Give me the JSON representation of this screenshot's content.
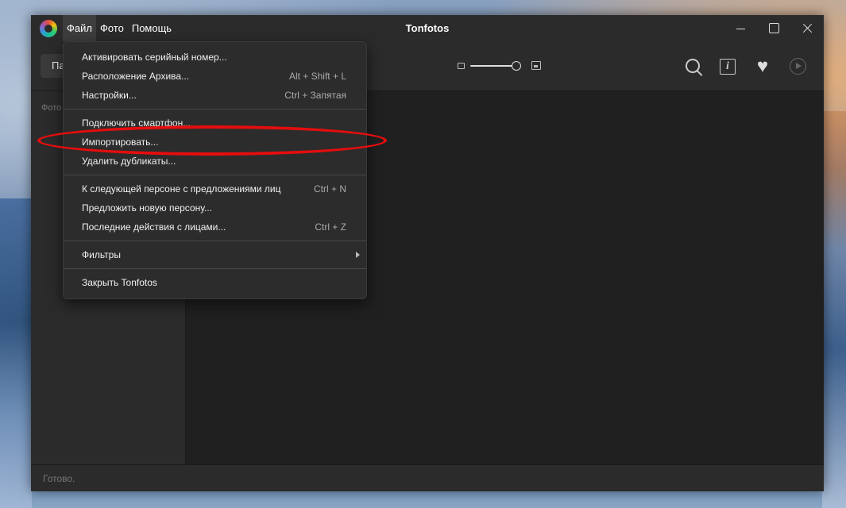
{
  "window": {
    "title": "Tonfotos",
    "menu": [
      "Файл",
      "Фото",
      "Помощь"
    ]
  },
  "toolbar": {
    "tab_partial_label": "Па",
    "zoom_slider_fraction": 1.0
  },
  "sidebar": {
    "section_label": "Фото"
  },
  "status": {
    "text": "Готово."
  },
  "file_menu": {
    "items": [
      {
        "label": "Активировать серийный номер...",
        "shortcut": ""
      },
      {
        "label": "Расположение Архива...",
        "shortcut": "Alt + Shift + L"
      },
      {
        "label": "Настройки...",
        "shortcut": "Ctrl + Запятая"
      },
      {
        "label": "Подключить смартфон...",
        "shortcut": ""
      },
      {
        "label": "Импортировать...",
        "shortcut": ""
      },
      {
        "label": "Удалить дубликаты...",
        "shortcut": ""
      },
      {
        "label": "К следующей персоне с предложениями лиц",
        "shortcut": "Ctrl + N"
      },
      {
        "label": "Предложить новую персону...",
        "shortcut": ""
      },
      {
        "label": "Последние действия с лицами...",
        "shortcut": "Ctrl + Z"
      },
      {
        "label": "Фильтры",
        "shortcut": ""
      },
      {
        "label": "Закрыть Tonfotos",
        "shortcut": ""
      }
    ]
  },
  "colors": {
    "highlight_ellipse": "#e50d0d",
    "window_bg": "#202020",
    "panel_bg": "#2b2b2b"
  },
  "icons": [
    "app-logo-icon",
    "minimize-icon",
    "maximize-icon",
    "close-icon",
    "search-icon",
    "info-icon",
    "heart-icon",
    "play-icon",
    "small-image-icon",
    "large-image-icon",
    "chevron-right-icon"
  ]
}
